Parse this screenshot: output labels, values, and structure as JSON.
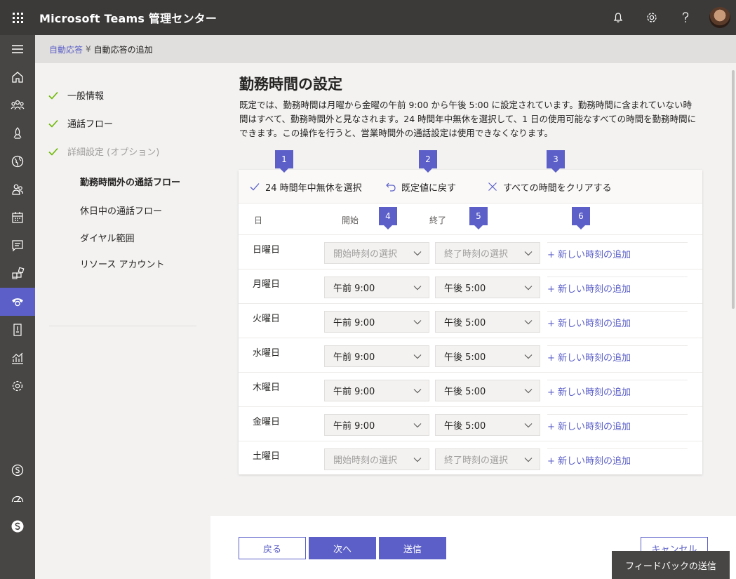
{
  "app": {
    "title": "Microsoft Teams 管理センター"
  },
  "breadcrumb": {
    "link": "自動応答",
    "separator": "¥",
    "current": "自動応答の追加"
  },
  "steps": [
    {
      "label": "一般情報",
      "state": "done"
    },
    {
      "label": "通話フロー",
      "state": "done"
    },
    {
      "label": "詳細設定 (オプション)",
      "state": "muted"
    }
  ],
  "substeps": [
    {
      "label": "勤務時間外の通話フロー",
      "current": true
    },
    {
      "label": "休日中の通話フロー",
      "current": false
    },
    {
      "label": "ダイヤル範囲",
      "current": false
    },
    {
      "label": "リソース アカウント",
      "current": false
    }
  ],
  "main": {
    "title": "勤務時間の設定",
    "intro": "既定では、勤務時間は月曜から金曜の午前 9:00 から午後 5:00 に設定されています。勤務時間に含まれていない時間はすべて、勤務時間外と見なされます。24 時間年中無休を選択して、1 日の使用可能なすべての時間を勤務時間にできます。この操作を行うと、営業時間外の通話設定は使用できなくなります。"
  },
  "toolbar": {
    "all_day": "24 時間年中無休を選択",
    "reset": "既定値に戻す",
    "clear": "すべての時間をクリアする"
  },
  "columns": {
    "day": "日",
    "start": "開始",
    "end": "終了"
  },
  "markers": [
    "1",
    "2",
    "3",
    "4",
    "5",
    "6"
  ],
  "rows": [
    {
      "day": "日曜日",
      "start": "開始時刻の選択",
      "end": "終了時刻の選択",
      "add": "+ 新しい時刻の追加",
      "placeholder": true
    },
    {
      "day": "月曜日",
      "start": "午前 9:00",
      "end": "午後 5:00",
      "add": "+ 新しい時刻の追加",
      "placeholder": false
    },
    {
      "day": "火曜日",
      "start": "午前 9:00",
      "end": "午後 5:00",
      "add": "+ 新しい時刻の追加",
      "placeholder": false
    },
    {
      "day": "水曜日",
      "start": "午前 9:00",
      "end": "午後 5:00",
      "add": "+ 新しい時刻の追加",
      "placeholder": false
    },
    {
      "day": "木曜日",
      "start": "午前 9:00",
      "end": "午後 5:00",
      "add": "+ 新しい時刻の追加",
      "placeholder": false
    },
    {
      "day": "金曜日",
      "start": "午前 9:00",
      "end": "午後 5:00",
      "add": "+ 新しい時刻の追加",
      "placeholder": false
    },
    {
      "day": "土曜日",
      "start": "開始時刻の選択",
      "end": "終了時刻の選択",
      "add": "+ 新しい時刻の追加",
      "placeholder": true
    }
  ],
  "footer": {
    "back": "戻る",
    "next": "次へ",
    "submit": "送信",
    "cancel": "キャンセル",
    "feedback": "フィードバックの送信"
  },
  "colors": {
    "accent": "#5b5fc7",
    "check": "#6bb700",
    "topbar": "#3b3a39",
    "rail": "#484644"
  },
  "rail_icons": [
    "hamburger-icon",
    "home-icon",
    "teams-icon",
    "deploy-icon",
    "globe-icon",
    "users-icon",
    "meetings-icon",
    "messaging-icon",
    "apps-icon",
    "voice-icon",
    "policy-icon",
    "analytics-icon",
    "settings-icon",
    "skype-icon",
    "dashboard-icon",
    "skype-business-icon"
  ]
}
